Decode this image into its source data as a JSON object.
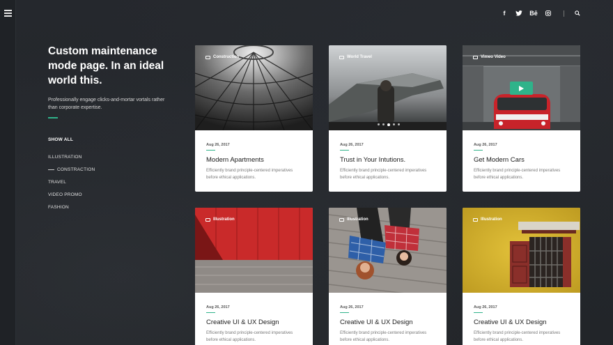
{
  "intro": {
    "heading": "Custom maintenance mode page. In an ideal world this.",
    "text": "Professionally engage clicks-and-mortar vortals rather than corporate expertise."
  },
  "filters": {
    "show_all": "SHOW ALL",
    "items": [
      "ILLUSTRATION",
      "CONSTRACTION",
      "TRAVEL",
      "VIDEO PROMO",
      "FASHION"
    ],
    "active_index": 1
  },
  "social_icons": [
    "facebook-icon",
    "twitter-icon",
    "behance-icon",
    "instagram-icon"
  ],
  "social_glyphs": [
    "f",
    "Bē"
  ],
  "cards": [
    {
      "category": "Construction",
      "date": "Aug 26, 2017",
      "title": "Modern Apartments",
      "desc": "Efficiently brand principle-centered imperatives before ethical applications."
    },
    {
      "category": "World Travel",
      "date": "Aug 26, 2017",
      "title": "Trust in Your Intutions.",
      "desc": "Efficiently brand principle-centered imperatives before ethical applications."
    },
    {
      "category": "Vimeo Video",
      "date": "Aug 26, 2017",
      "title": "Get Modern Cars",
      "desc": "Efficiently brand principle-centered imperatives before ethical applications."
    },
    {
      "category": "Illustration",
      "date": "Aug 26, 2017",
      "title": "Creative UI & UX Design",
      "desc": "Efficiently brand principle-centered imperatives before ethical applications."
    },
    {
      "category": "Illustration",
      "date": "Aug 26, 2017",
      "title": "Creative UI & UX Design",
      "desc": "Efficiently brand principle-centered imperatives before ethical applications."
    },
    {
      "category": "Illustration",
      "date": "Aug 26, 2017",
      "title": "Creative UI & UX Design",
      "desc": "Efficiently brand principle-centered imperatives before ethical applications."
    }
  ],
  "colors": {
    "accent": "#2fb38a",
    "background": "#24272c"
  }
}
